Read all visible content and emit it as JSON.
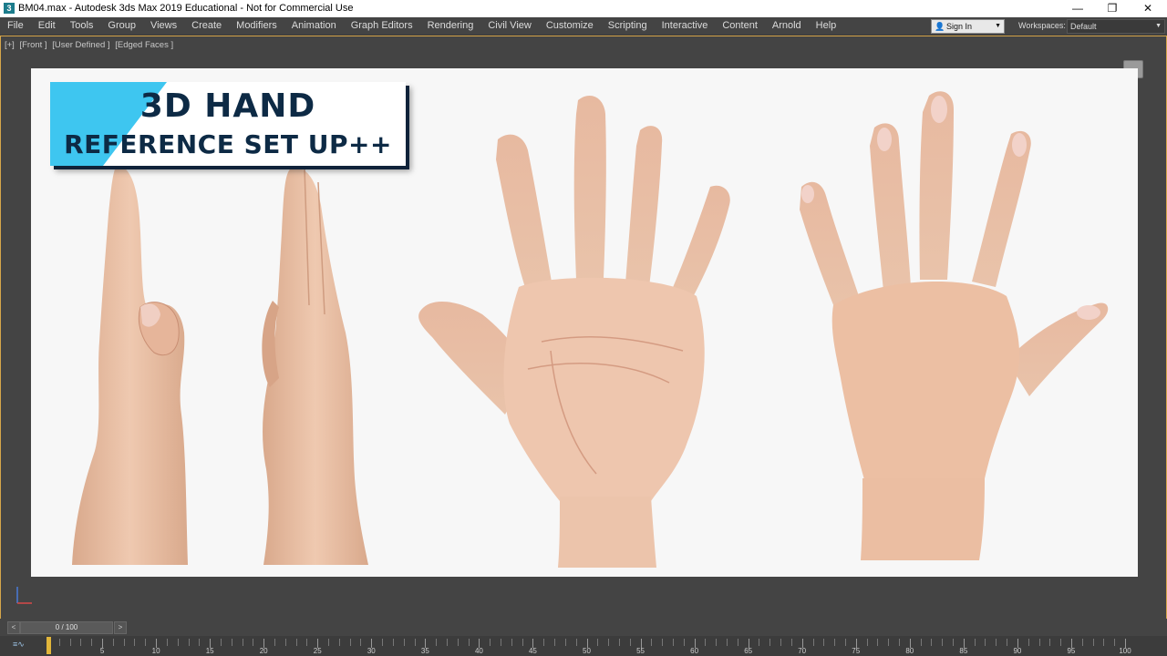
{
  "titlebar": {
    "app_icon": "3ds-max-icon",
    "title": "BM04.max - Autodesk 3ds Max 2019 Educational - Not for Commercial Use",
    "minimize": "—",
    "restore": "❐",
    "close": "✕"
  },
  "menu": {
    "items": [
      "File",
      "Edit",
      "Tools",
      "Group",
      "Views",
      "Create",
      "Modifiers",
      "Animation",
      "Graph Editors",
      "Rendering",
      "Civil View",
      "Customize",
      "Scripting",
      "Interactive",
      "Content",
      "Arnold",
      "Help"
    ],
    "signin_label": "Sign In",
    "workspaces_label": "Workspaces:",
    "workspace_value": "Default"
  },
  "viewport": {
    "label_parts": [
      "[+]",
      "[Front ]",
      "[User Defined ]",
      "[Edged Faces ]"
    ],
    "accent_border": "#d6a64a"
  },
  "banner": {
    "line1": "3D HAND",
    "line2": "REFERENCE SET UP++",
    "accent_color": "#3ec6f0",
    "text_color": "#0d2a45"
  },
  "timeline": {
    "current": "0 / 100",
    "prev_label": "<",
    "next_label": ">",
    "tick_labels": [
      "0",
      "5",
      "10",
      "15",
      "20",
      "25",
      "30",
      "35",
      "40",
      "45",
      "50",
      "55",
      "60",
      "65",
      "70",
      "75",
      "80",
      "85",
      "90",
      "95",
      "100"
    ]
  },
  "colors": {
    "skin": "#eac1a6",
    "skin_shadow": "#d29d80",
    "nail": "#f2d2c9"
  }
}
